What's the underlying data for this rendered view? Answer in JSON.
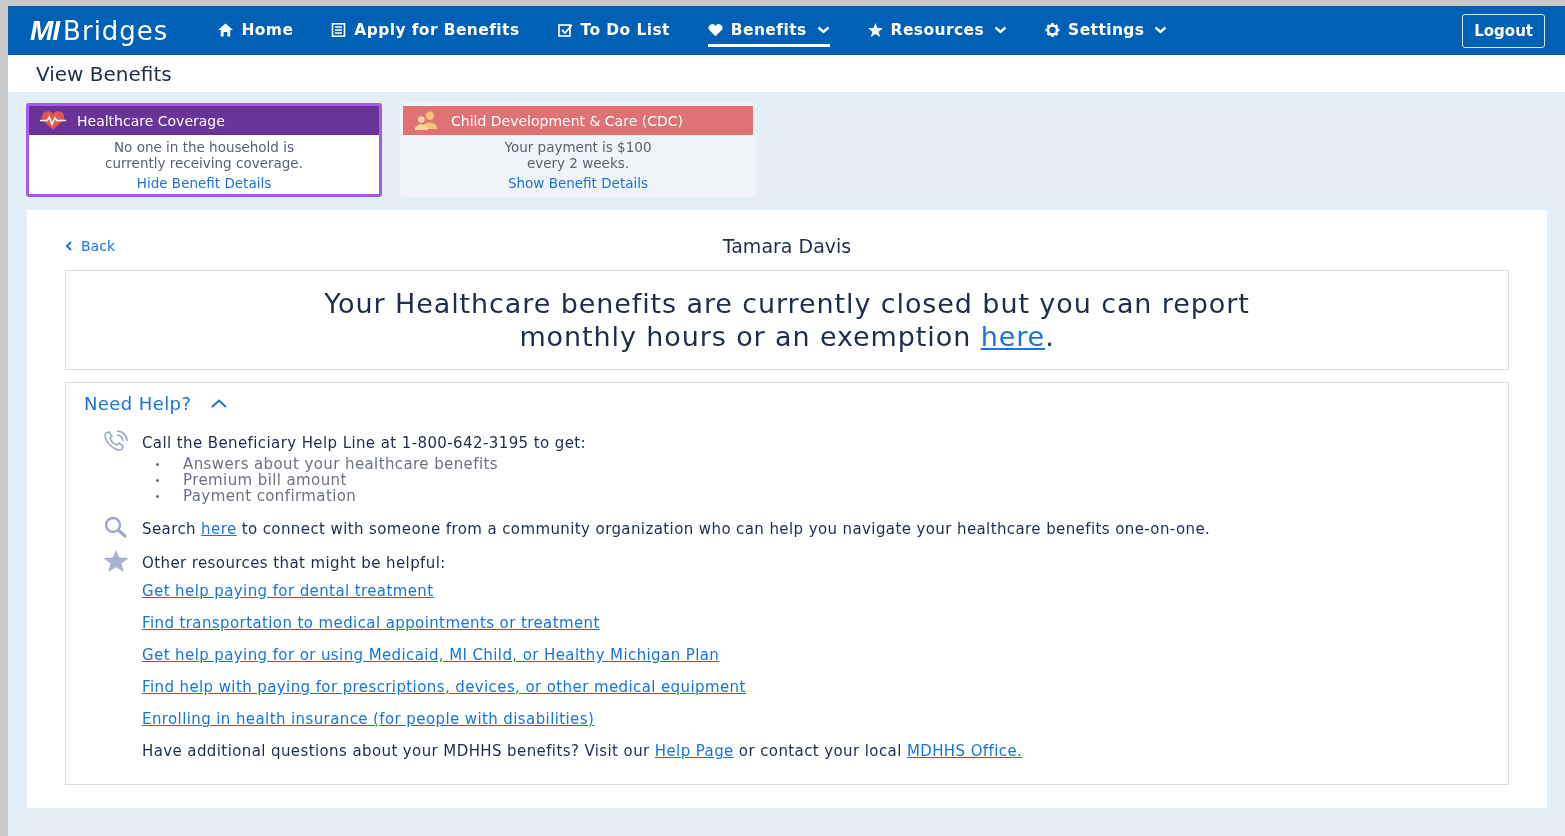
{
  "logo": {
    "mark": "MI",
    "name": "Bridges"
  },
  "nav": [
    {
      "label": "Home",
      "selected": false,
      "dropdown": false
    },
    {
      "label": "Apply for Benefits",
      "selected": false,
      "dropdown": false
    },
    {
      "label": "To Do List",
      "selected": false,
      "dropdown": false
    },
    {
      "label": "Benefits",
      "selected": true,
      "dropdown": true
    },
    {
      "label": "Resources",
      "selected": false,
      "dropdown": true
    },
    {
      "label": "Settings",
      "selected": false,
      "dropdown": true
    }
  ],
  "logout": "Logout",
  "page_title": "View Benefits",
  "benefit_cards": [
    {
      "title": "Healthcare Coverage",
      "color": "#6a3397",
      "selected": true,
      "lines": [
        "No one in the household is",
        "currently receiving coverage."
      ],
      "link": "Hide Benefit Details"
    },
    {
      "title": "Child Development & Care (CDC)",
      "color": "#e07275",
      "selected": false,
      "lines": [
        "Your payment is $100",
        "every 2 weeks."
      ],
      "link": "Show Benefit Details"
    }
  ],
  "back": "Back",
  "person_name": "Tamara Davis",
  "notice": [
    {
      "kind": "text",
      "text": "Your Healthcare benefits are currently closed but you can report monthly hours or an exemption "
    },
    {
      "kind": "link",
      "text": "here"
    },
    {
      "kind": "text",
      "text": "."
    }
  ],
  "help": {
    "title": "Need Help?",
    "expanded": true,
    "sections": [
      {
        "text": [
          {
            "kind": "text",
            "text": "Call the Beneficiary Help Line at 1-800-642-3195 to get:"
          }
        ],
        "bullets": [
          "Answers about your healthcare benefits",
          "Premium bill amount",
          "Payment confirmation"
        ]
      },
      {
        "text": [
          {
            "kind": "text",
            "text": "Search "
          },
          {
            "kind": "link",
            "text": "here"
          },
          {
            "kind": "text",
            "text": " to connect with someone from a community organization who can help you navigate your healthcare benefits one-on-one."
          }
        ]
      },
      {
        "text": [
          {
            "kind": "text",
            "text": "Other resources that might be helpful:"
          }
        ]
      }
    ],
    "links": [
      "Get help paying for dental treatment",
      "Find transportation to medical appointments or treatment",
      "Get help paying for or using Medicaid, MI Child, or Healthy Michigan Plan",
      "Find help with paying for prescriptions, devices, or other medical equipment",
      "Enrolling in health insurance (for people with disabilities)"
    ],
    "footer": [
      {
        "kind": "text",
        "text": "Have additional questions about your MDHHS benefits? Visit our "
      },
      {
        "kind": "link",
        "text": "Help Page"
      },
      {
        "kind": "text",
        "text": " or contact your local "
      },
      {
        "kind": "link",
        "text": "MDHHS Office."
      }
    ]
  }
}
